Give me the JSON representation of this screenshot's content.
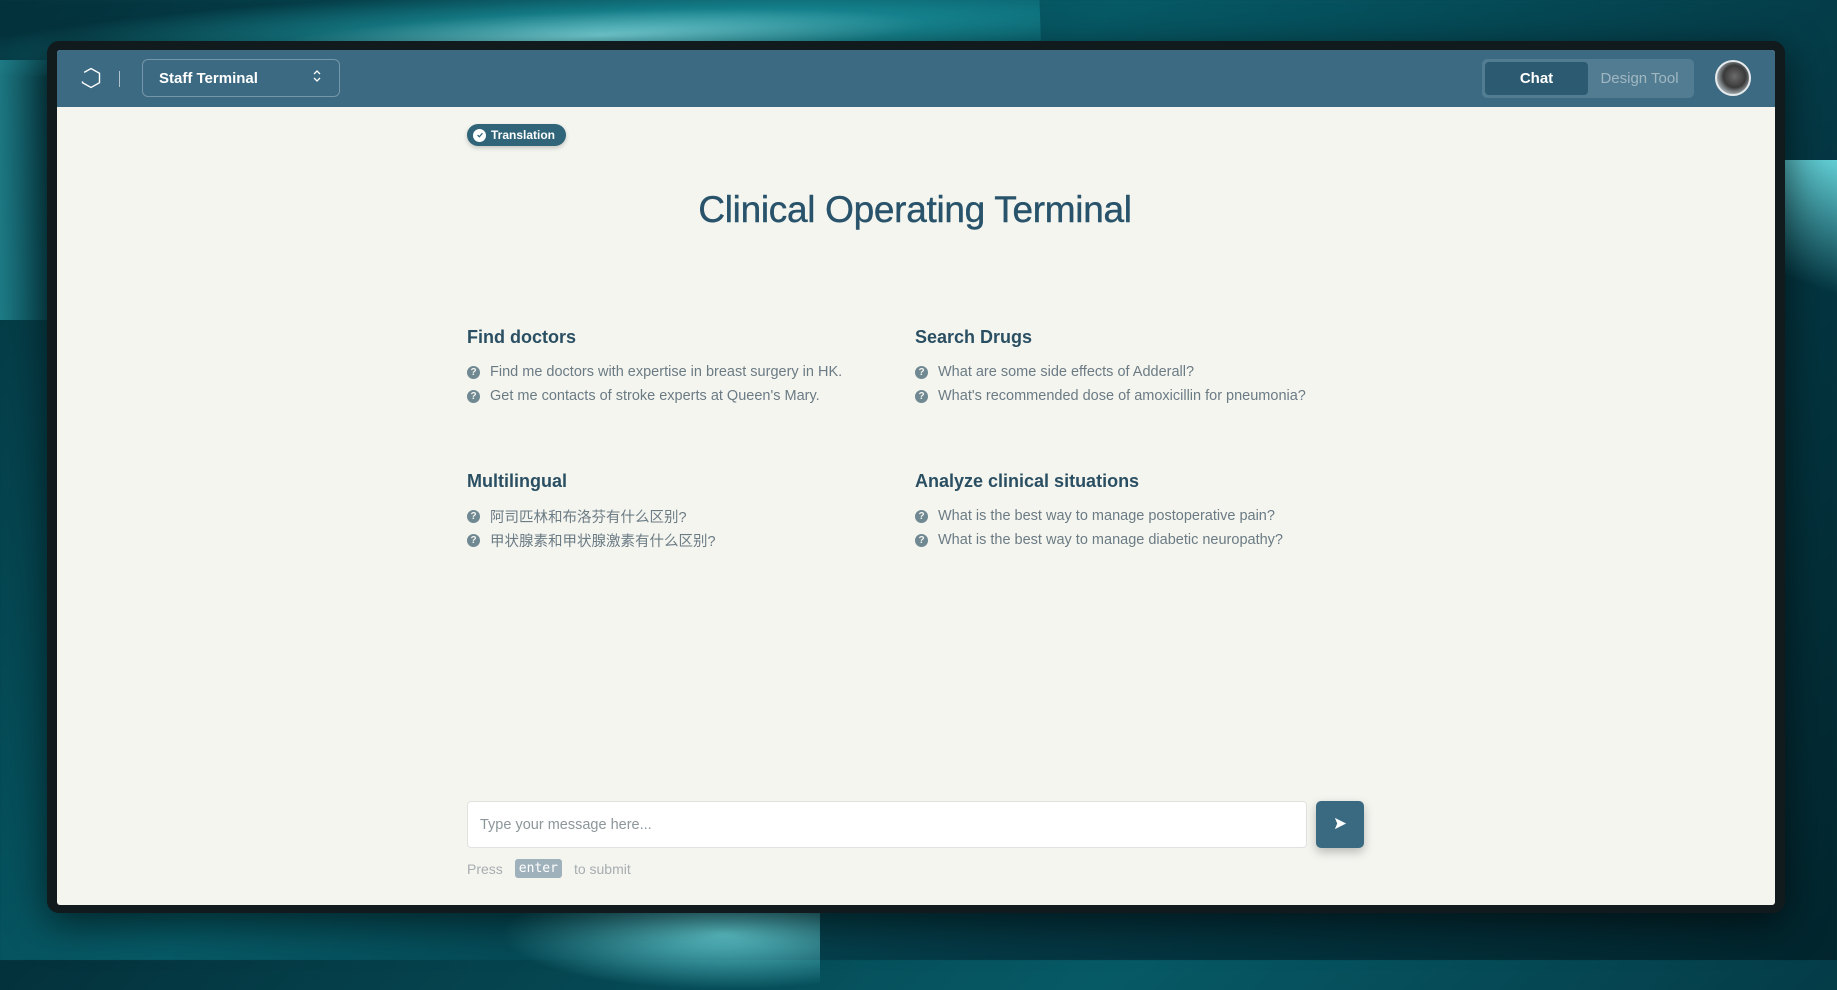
{
  "header": {
    "logo_icon": "hexagon-logo-icon",
    "terminal_select": {
      "selected": "Staff Terminal",
      "icon": "chevron-up-down-icon"
    },
    "mode_tabs": [
      {
        "label": "Chat",
        "active": true
      },
      {
        "label": "Design Tool",
        "active": false
      }
    ],
    "avatar": "user-avatar"
  },
  "main": {
    "badge": {
      "label": "Translation",
      "icon": "check-circle-icon"
    },
    "title": "Clinical Operating Terminal",
    "sections": [
      {
        "heading": "Find doctors",
        "items": [
          "Find me doctors with expertise in breast surgery in HK.",
          "Get me contacts of stroke experts at Queen's Mary."
        ]
      },
      {
        "heading": "Search Drugs",
        "items": [
          "What are some side effects of Adderall?",
          "What's recommended dose of amoxicillin for pneumonia?"
        ]
      },
      {
        "heading": "Multilingual",
        "items": [
          "阿司匹林和布洛芬有什么区别?",
          "甲状腺素和甲状腺激素有什么区别?"
        ]
      },
      {
        "heading": "Analyze clinical situations",
        "items": [
          "What is the best way to manage postoperative pain?",
          "What is the best way to manage diabetic neuropathy?"
        ]
      }
    ]
  },
  "composer": {
    "placeholder": "Type your message here...",
    "send_icon": "send-arrow-icon",
    "hint_prefix": "Press",
    "hint_key": "enter",
    "hint_suffix": "to submit"
  },
  "colors": {
    "header": "#3b6a82",
    "accent": "#2f6479",
    "title": "#28536a",
    "background": "#f5f5f0"
  }
}
